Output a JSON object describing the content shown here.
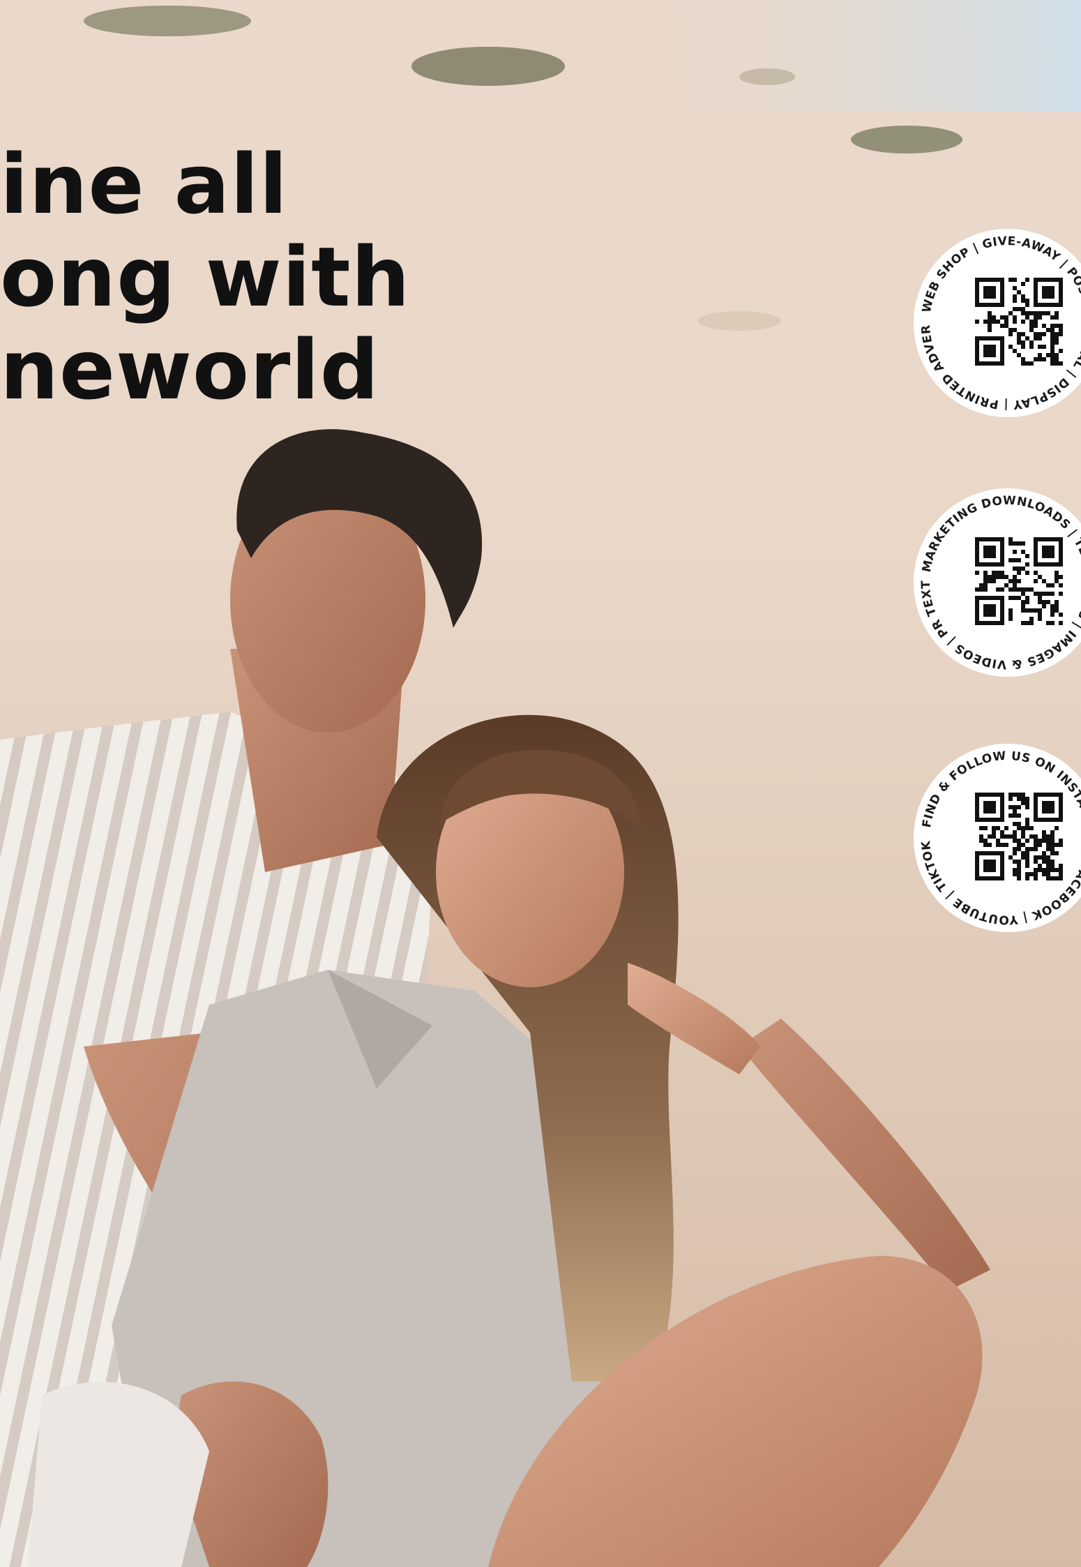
{
  "headline": {
    "line1": "ine all",
    "line2": "ong with",
    "line3": "neworld"
  },
  "badges": [
    {
      "id": "webshop",
      "ring_text": "WEB SHOP | GIVE-AWAY | POS MATERIAL | DISPLAY | PRINTED ADVERTISING MATERIAL | ",
      "qr_icon": "qr-code-icon"
    },
    {
      "id": "marketing",
      "ring_text": "MARKETING DOWNLOADS | TEMPLATES | IMAGES & VIDEOS | PR TEXTS | ",
      "qr_icon": "qr-code-icon"
    },
    {
      "id": "social",
      "ring_text": "FIND & FOLLOW US ON INSTAGRAM | FACEBOOK | YOUTUBE | TIKTOK | ",
      "qr_icon": "qr-code-icon"
    }
  ],
  "colors": {
    "sand_light": "#efe2d6",
    "sand_mid": "#dcc6b4",
    "sky": "#cfe0ea",
    "text": "#111111",
    "badge_bg": "#ffffff"
  }
}
